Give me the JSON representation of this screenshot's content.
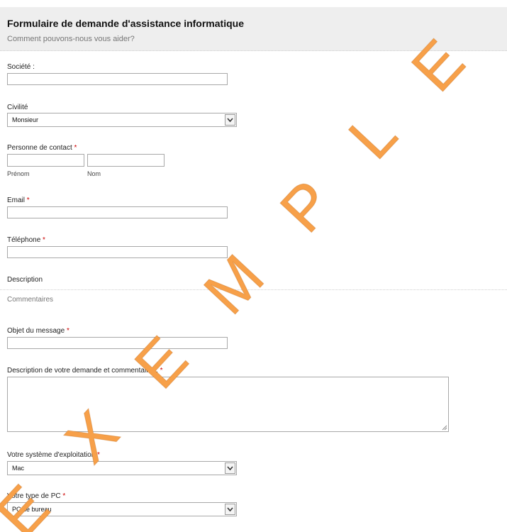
{
  "header": {
    "title": "Formulaire de demande d'assistance informatique",
    "subtitle": "Comment pouvons-nous vous aider?"
  },
  "fields": {
    "societe": {
      "label": "Société :"
    },
    "civilite": {
      "label": "Civilité",
      "value": "Monsieur"
    },
    "contact": {
      "label": "Personne de contact",
      "first_sublabel": "Prénom",
      "last_sublabel": "Nom"
    },
    "email": {
      "label": "Email"
    },
    "telephone": {
      "label": "Téléphone"
    },
    "objet": {
      "label": "Objet du message"
    },
    "description": {
      "label": "Description de votre demande et commentaires."
    },
    "os": {
      "label": "Votre système d'exploitation",
      "value": "Mac"
    },
    "pc_type": {
      "label": "Votre type de PC",
      "value": "PC de bureau"
    }
  },
  "section": {
    "title": "Description",
    "subtitle": "Commentaires"
  },
  "required_mark": "*",
  "watermark": {
    "text": "E X E M P L E",
    "color": "#f7a049"
  }
}
